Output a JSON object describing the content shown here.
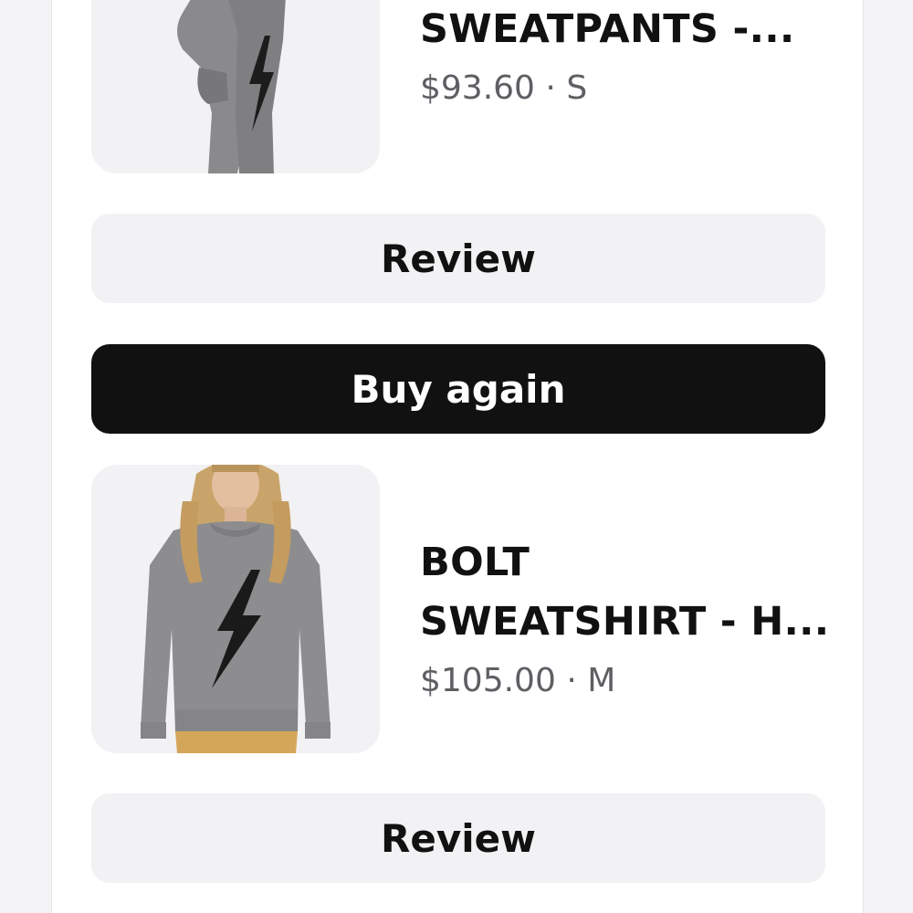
{
  "orders": [
    {
      "title_lines": [
        "SWEATPANTS -..."
      ],
      "price": "$93.60",
      "separator": "·",
      "size": "S",
      "image_icon": "sweatpants-image",
      "review_label": "Review",
      "buy_again_label": "Buy again"
    },
    {
      "title_lines": [
        "BOLT",
        "SWEATSHIRT - H..."
      ],
      "price": "$105.00",
      "separator": "·",
      "size": "M",
      "image_icon": "sweatshirt-image",
      "review_label": "Review"
    }
  ],
  "colors": {
    "primary_button": "#111111",
    "secondary_button": "#f2f2f4",
    "title_text": "#111111",
    "meta_text": "#5e5e63"
  }
}
